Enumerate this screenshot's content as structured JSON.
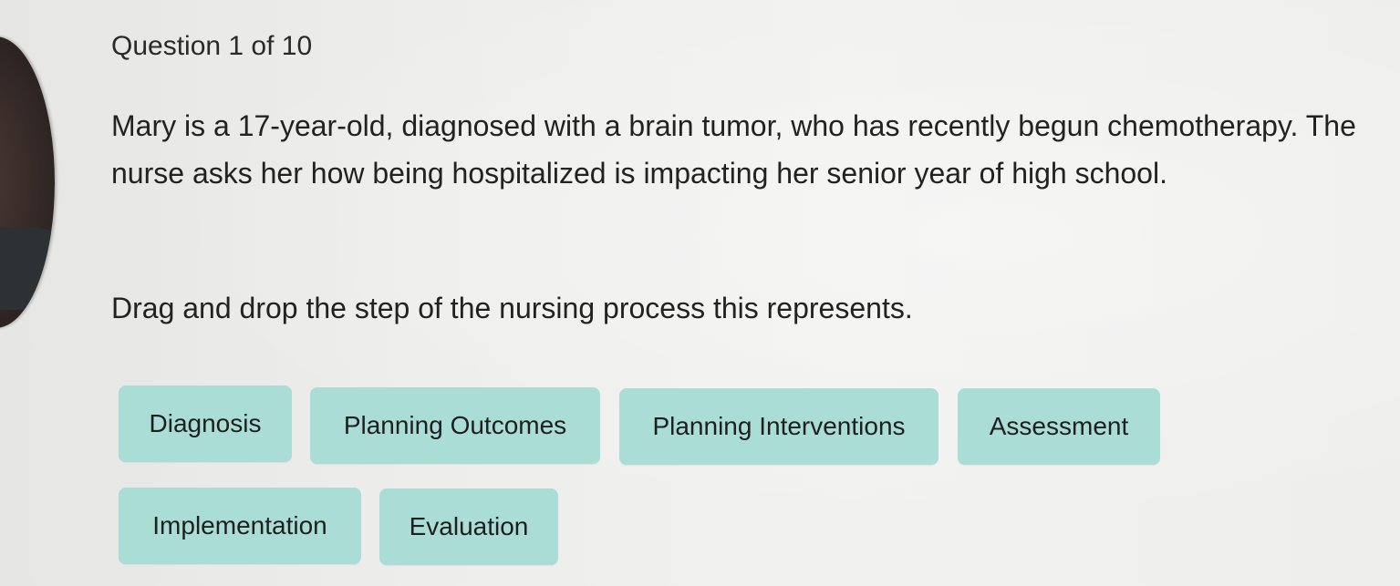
{
  "quiz": {
    "counter": "Question 1 of 10",
    "question": "Mary is a 17-year-old, diagnosed with a brain tumor, who has recently begun chemotherapy. The nurse asks her how being hospitalized is impacting her senior year of high school.",
    "instruction": "Drag and drop the step of the nursing process this represents."
  },
  "options": [
    {
      "label": "Diagnosis"
    },
    {
      "label": "Planning Outcomes"
    },
    {
      "label": "Planning Interventions"
    },
    {
      "label": "Assessment"
    },
    {
      "label": "Implementation"
    },
    {
      "label": "Evaluation"
    }
  ],
  "colors": {
    "option_bg": "#a9ddd6",
    "page_bg": "#ededeb",
    "text": "#222222"
  }
}
